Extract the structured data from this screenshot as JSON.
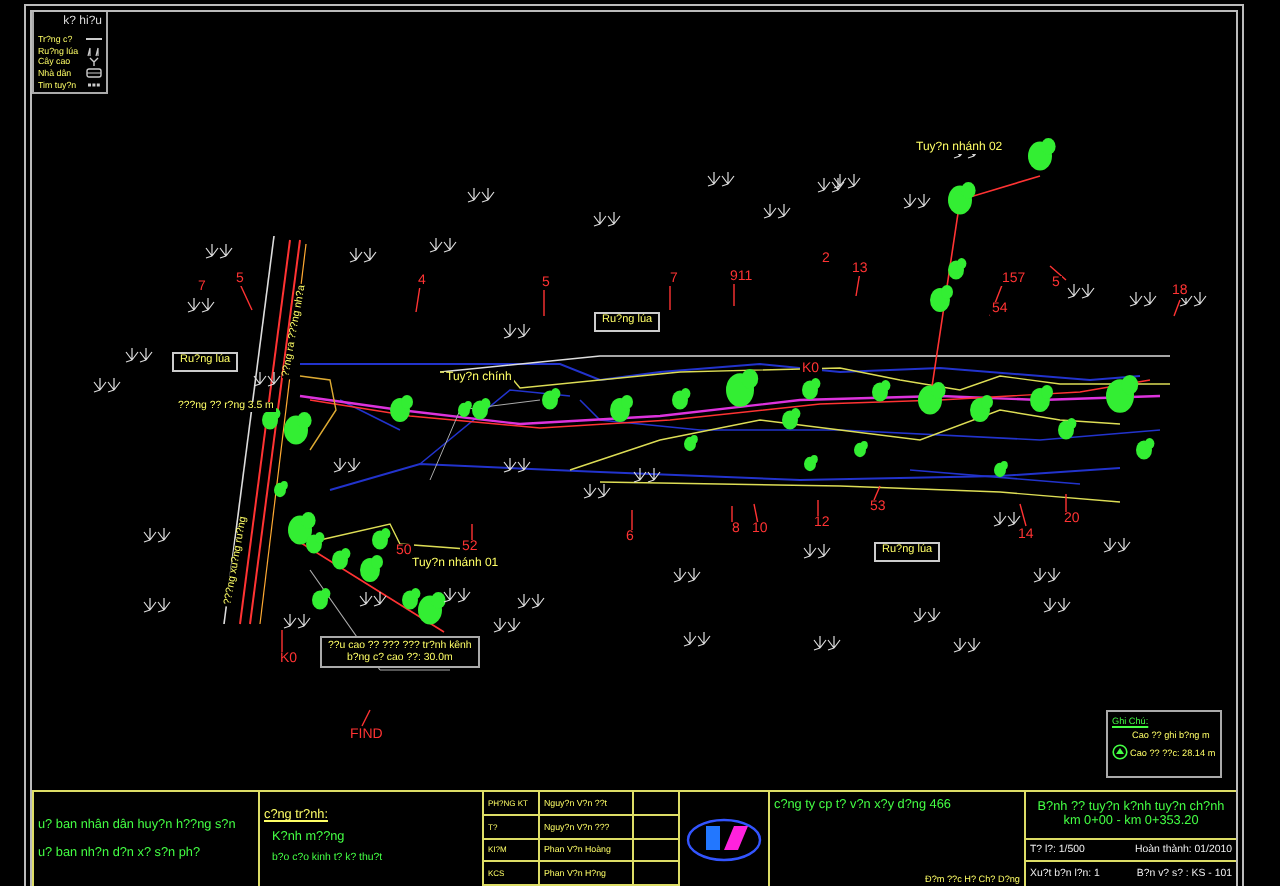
{
  "legend": {
    "title": "k? hi?u",
    "items": [
      {
        "kind": "line",
        "label": "Tr?ng c?"
      },
      {
        "kind": "grass",
        "label": "Ru?ng lúa"
      },
      {
        "kind": "tree",
        "label": "Cây cao"
      },
      {
        "kind": "house",
        "label": "Nhà dân"
      },
      {
        "kind": "centerline",
        "label": "Tim tuy?n"
      }
    ]
  },
  "map": {
    "area_labels": [
      "Ru?ng lúa",
      "Ru?ng lúa",
      "Ru?ng lúa"
    ],
    "route_labels": [
      "Tuy?n nhánh 02",
      "Tuy?n chính",
      "Tuy?n nhánh 01"
    ],
    "road_labels": [
      "???ng ?? r?ng 3.5 m",
      "??ng ra ???ng nh?a",
      "???ng xu?ng ru?ng"
    ],
    "callout": [
      "??u cao ?? ??? ??? tr?nh kênh",
      "b?ng c? cao ??: 30.0m"
    ],
    "stations": [
      "5",
      "4",
      "5",
      "7",
      "7",
      "911",
      "2",
      "13",
      "157",
      "54",
      "5",
      "18",
      "K0",
      "6",
      "8",
      "10",
      "12",
      "53",
      "14",
      "20",
      "52",
      "50",
      "K0",
      "FIND"
    ]
  },
  "note": {
    "title": "Ghi Chú:",
    "lines": [
      "Cao ?? ghi b?ng m",
      "Cao ?? ??c: 28.14 m"
    ]
  },
  "title_block": {
    "authority": [
      "u? ban nhân dân huy?n h??ng s?n",
      "u? ban nh?n d?n x? s?n ph?"
    ],
    "project_heading": "c?ng tr?nh:",
    "project_lines": [
      "K?nh m??ng",
      "b?o c?o kinh t? k? thu?t"
    ],
    "signatures": [
      {
        "role": "PH?NG KT",
        "name": "Nguy?n V?n ??t"
      },
      {
        "role": "T?",
        "name": "Nguy?n V?n ???"
      },
      {
        "role": "KI?M",
        "name": "Phan V?n Hoàng"
      },
      {
        "role": "KCS",
        "name": "Phan V?n H?ng"
      }
    ],
    "company": "c?ng ty cp t? v?n x?y d?ng 466",
    "director": "Đ?m ??c H? Ch? D?ng",
    "drawing_title": "B?nh ?? tuy?n k?nh tuy?n ch?nh",
    "drawing_range": "km 0+00 - km 0+353.20",
    "scale": "T? l?: 1/500",
    "completed": "Hoàn thành: 01/2010",
    "edition": "Xu?t b?n l?n: 1",
    "sheet_no": "B?n v? s? : KS - 101"
  }
}
